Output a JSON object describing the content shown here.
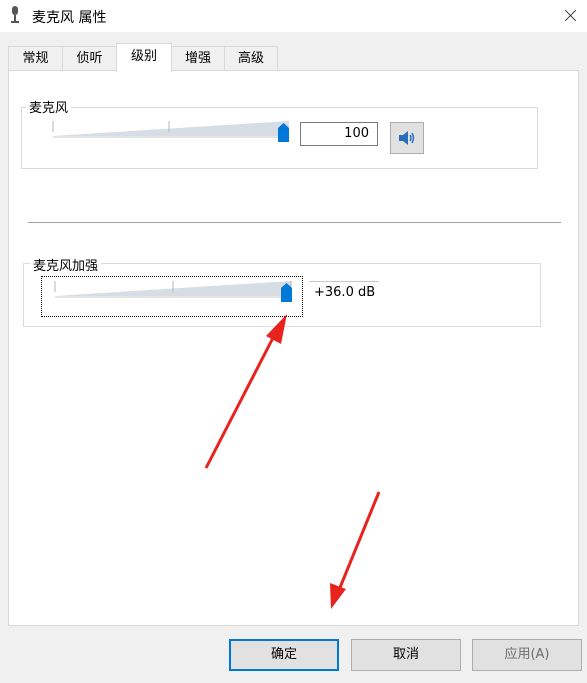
{
  "window": {
    "title": "麦克风 属性",
    "icon": "microphone-icon"
  },
  "tabs": [
    {
      "label": "常规",
      "active": false
    },
    {
      "label": "侦听",
      "active": false
    },
    {
      "label": "级别",
      "active": true
    },
    {
      "label": "增强",
      "active": false
    },
    {
      "label": "高级",
      "active": false
    }
  ],
  "microphone": {
    "label": "麦克风",
    "level": 100,
    "level_text": "100",
    "mute_icon": "speaker-icon"
  },
  "boost": {
    "label": "麦克风加强",
    "value_text": "+36.0 dB",
    "level_fraction": 1.0
  },
  "buttons": {
    "ok": "确定",
    "cancel": "取消",
    "apply": "应用(A)"
  },
  "colors": {
    "thumb": "#0078d7",
    "arrow": "#e8231e",
    "default_border": "#0078d7"
  }
}
